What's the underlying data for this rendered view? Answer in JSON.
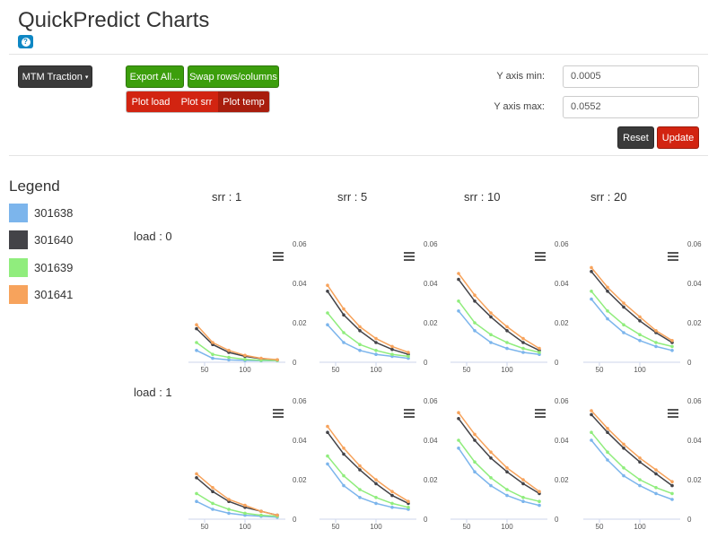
{
  "app": {
    "title": "QuickPredict Charts",
    "help_icon": "question-mark-icon"
  },
  "toolbar": {
    "dropdown_label": "MTM Traction",
    "export_label": "Export All...",
    "swap_label": "Swap rows/columns",
    "plot_load_label": "Plot load",
    "plot_srr_label": "Plot srr",
    "plot_temp_label": "Plot temp"
  },
  "axis_controls": {
    "ymin_label": "Y axis min:",
    "ymin_value": "0.0005",
    "ymax_label": "Y axis max:",
    "ymax_value": "0.0552",
    "reset_label": "Reset",
    "update_label": "Update"
  },
  "legend": {
    "title": "Legend",
    "items": [
      {
        "label": "301638",
        "color": "#7cb5ec"
      },
      {
        "label": "301640",
        "color": "#434348"
      },
      {
        "label": "301639",
        "color": "#90ed7d"
      },
      {
        "label": "301641",
        "color": "#f7a35c"
      }
    ]
  },
  "grid": {
    "columns": [
      "srr : 1",
      "srr : 5",
      "srr : 10",
      "srr : 20"
    ],
    "rows": [
      "load : 0",
      "load : 1"
    ]
  },
  "chart_data": [
    {
      "type": "line",
      "row": "load : 0",
      "column": "srr : 1",
      "x": [
        40,
        60,
        80,
        100,
        120,
        140
      ],
      "xticks": [
        50,
        100
      ],
      "yticks": [
        0,
        0.02,
        0.04,
        0.06
      ],
      "ylim": [
        0,
        0.06
      ],
      "series": [
        {
          "name": "301638",
          "values": [
            0.006,
            0.002,
            0.0012,
            0.0009,
            0.0008,
            0.0008
          ]
        },
        {
          "name": "301640",
          "values": [
            0.017,
            0.009,
            0.005,
            0.003,
            0.0018,
            0.0012
          ]
        },
        {
          "name": "301639",
          "values": [
            0.01,
            0.004,
            0.0025,
            0.0015,
            0.001,
            0.0009
          ]
        },
        {
          "name": "301641",
          "values": [
            0.019,
            0.01,
            0.006,
            0.0035,
            0.002,
            0.0013
          ]
        }
      ]
    },
    {
      "type": "line",
      "row": "load : 0",
      "column": "srr : 5",
      "x": [
        40,
        60,
        80,
        100,
        120,
        140
      ],
      "xticks": [
        50,
        100
      ],
      "yticks": [
        0,
        0.02,
        0.04,
        0.06
      ],
      "ylim": [
        0,
        0.06
      ],
      "series": [
        {
          "name": "301638",
          "values": [
            0.019,
            0.01,
            0.006,
            0.004,
            0.003,
            0.002
          ]
        },
        {
          "name": "301640",
          "values": [
            0.036,
            0.024,
            0.016,
            0.01,
            0.0065,
            0.004
          ]
        },
        {
          "name": "301639",
          "values": [
            0.025,
            0.015,
            0.009,
            0.006,
            0.004,
            0.003
          ]
        },
        {
          "name": "301641",
          "values": [
            0.039,
            0.027,
            0.018,
            0.012,
            0.008,
            0.005
          ]
        }
      ]
    },
    {
      "type": "line",
      "row": "load : 0",
      "column": "srr : 10",
      "x": [
        40,
        60,
        80,
        100,
        120,
        140
      ],
      "xticks": [
        50,
        100
      ],
      "yticks": [
        0,
        0.02,
        0.04,
        0.06
      ],
      "ylim": [
        0,
        0.06
      ],
      "series": [
        {
          "name": "301638",
          "values": [
            0.026,
            0.016,
            0.01,
            0.007,
            0.005,
            0.004
          ]
        },
        {
          "name": "301640",
          "values": [
            0.042,
            0.031,
            0.023,
            0.016,
            0.01,
            0.006
          ]
        },
        {
          "name": "301639",
          "values": [
            0.031,
            0.02,
            0.014,
            0.01,
            0.007,
            0.005
          ]
        },
        {
          "name": "301641",
          "values": [
            0.045,
            0.034,
            0.025,
            0.018,
            0.012,
            0.007
          ]
        }
      ]
    },
    {
      "type": "line",
      "row": "load : 0",
      "column": "srr : 20",
      "x": [
        40,
        60,
        80,
        100,
        120,
        140
      ],
      "xticks": [
        50,
        100
      ],
      "yticks": [
        0,
        0.02,
        0.04,
        0.06
      ],
      "ylim": [
        0,
        0.06
      ],
      "series": [
        {
          "name": "301638",
          "values": [
            0.032,
            0.022,
            0.015,
            0.011,
            0.008,
            0.006
          ]
        },
        {
          "name": "301640",
          "values": [
            0.046,
            0.036,
            0.028,
            0.021,
            0.015,
            0.01
          ]
        },
        {
          "name": "301639",
          "values": [
            0.036,
            0.026,
            0.019,
            0.014,
            0.01,
            0.008
          ]
        },
        {
          "name": "301641",
          "values": [
            0.048,
            0.038,
            0.03,
            0.023,
            0.016,
            0.011
          ]
        }
      ]
    },
    {
      "type": "line",
      "row": "load : 1",
      "column": "srr : 1",
      "x": [
        40,
        60,
        80,
        100,
        120,
        140
      ],
      "xticks": [
        50,
        100
      ],
      "yticks": [
        0,
        0.02,
        0.04,
        0.06
      ],
      "ylim": [
        0,
        0.06
      ],
      "series": [
        {
          "name": "301638",
          "values": [
            0.009,
            0.005,
            0.003,
            0.002,
            0.0015,
            0.001
          ]
        },
        {
          "name": "301640",
          "values": [
            0.021,
            0.014,
            0.009,
            0.006,
            0.004,
            0.002
          ]
        },
        {
          "name": "301639",
          "values": [
            0.013,
            0.008,
            0.005,
            0.003,
            0.002,
            0.0015
          ]
        },
        {
          "name": "301641",
          "values": [
            0.023,
            0.016,
            0.01,
            0.007,
            0.004,
            0.002
          ]
        }
      ]
    },
    {
      "type": "line",
      "row": "load : 1",
      "column": "srr : 5",
      "x": [
        40,
        60,
        80,
        100,
        120,
        140
      ],
      "xticks": [
        50,
        100
      ],
      "yticks": [
        0,
        0.02,
        0.04,
        0.06
      ],
      "ylim": [
        0,
        0.06
      ],
      "series": [
        {
          "name": "301638",
          "values": [
            0.028,
            0.017,
            0.011,
            0.008,
            0.006,
            0.005
          ]
        },
        {
          "name": "301640",
          "values": [
            0.044,
            0.033,
            0.025,
            0.018,
            0.012,
            0.008
          ]
        },
        {
          "name": "301639",
          "values": [
            0.032,
            0.022,
            0.015,
            0.011,
            0.008,
            0.006
          ]
        },
        {
          "name": "301641",
          "values": [
            0.047,
            0.036,
            0.027,
            0.02,
            0.014,
            0.009
          ]
        }
      ]
    },
    {
      "type": "line",
      "row": "load : 1",
      "column": "srr : 10",
      "x": [
        40,
        60,
        80,
        100,
        120,
        140
      ],
      "xticks": [
        50,
        100
      ],
      "yticks": [
        0,
        0.02,
        0.04,
        0.06
      ],
      "ylim": [
        0,
        0.06
      ],
      "series": [
        {
          "name": "301638",
          "values": [
            0.036,
            0.024,
            0.017,
            0.012,
            0.009,
            0.007
          ]
        },
        {
          "name": "301640",
          "values": [
            0.051,
            0.04,
            0.031,
            0.024,
            0.018,
            0.013
          ]
        },
        {
          "name": "301639",
          "values": [
            0.04,
            0.029,
            0.021,
            0.015,
            0.011,
            0.009
          ]
        },
        {
          "name": "301641",
          "values": [
            0.054,
            0.043,
            0.034,
            0.026,
            0.02,
            0.014
          ]
        }
      ]
    },
    {
      "type": "line",
      "row": "load : 1",
      "column": "srr : 20",
      "x": [
        40,
        60,
        80,
        100,
        120,
        140
      ],
      "xticks": [
        50,
        100
      ],
      "yticks": [
        0,
        0.02,
        0.04,
        0.06
      ],
      "ylim": [
        0,
        0.06
      ],
      "series": [
        {
          "name": "301638",
          "values": [
            0.04,
            0.03,
            0.022,
            0.017,
            0.013,
            0.01
          ]
        },
        {
          "name": "301640",
          "values": [
            0.053,
            0.044,
            0.036,
            0.029,
            0.023,
            0.017
          ]
        },
        {
          "name": "301639",
          "values": [
            0.044,
            0.034,
            0.026,
            0.02,
            0.016,
            0.013
          ]
        },
        {
          "name": "301641",
          "values": [
            0.055,
            0.046,
            0.038,
            0.031,
            0.025,
            0.019
          ]
        }
      ]
    }
  ]
}
